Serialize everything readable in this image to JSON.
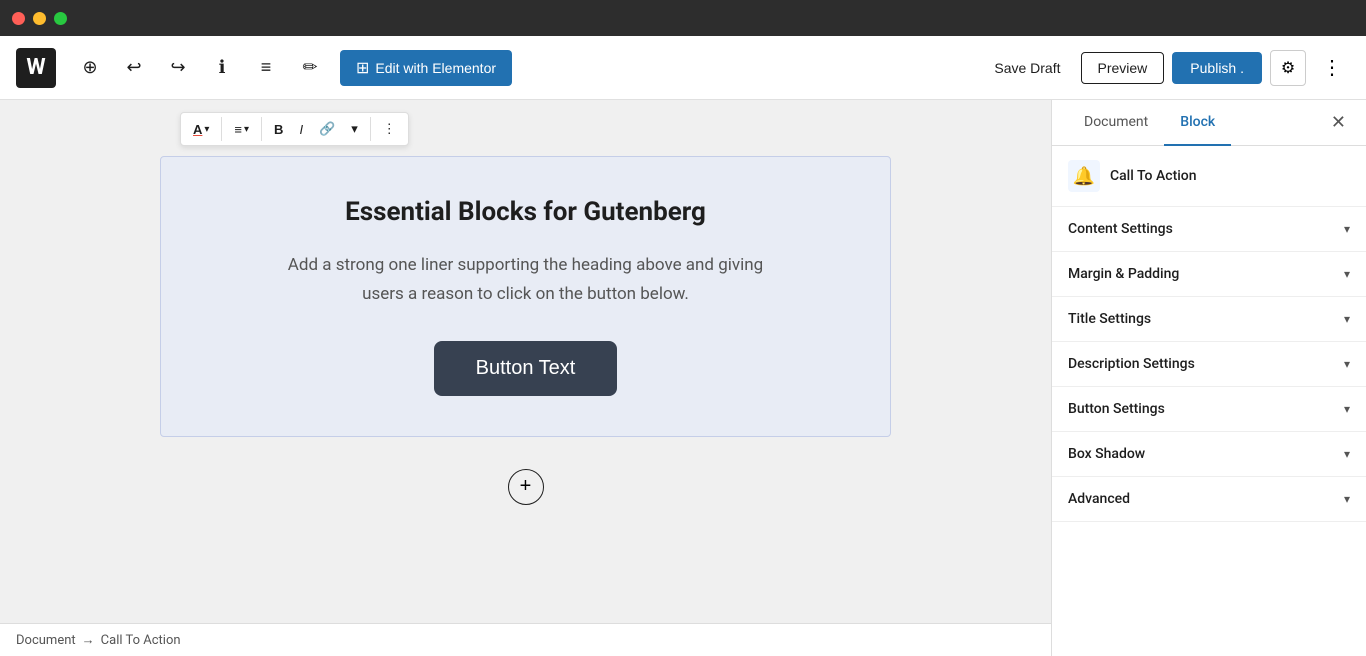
{
  "titlebar": {
    "buttons": [
      "close",
      "minimize",
      "maximize"
    ]
  },
  "toolbar": {
    "wp_logo": "W",
    "elementor_btn_label": "Edit with Elementor",
    "save_draft_label": "Save Draft",
    "preview_label": "Preview",
    "publish_label": "Publish .",
    "add_icon": "⊕",
    "undo_icon": "↩",
    "redo_icon": "↪",
    "info_icon": "ℹ",
    "list_icon": "≡",
    "edit_icon": "✏"
  },
  "block_toolbar": {
    "text_color_icon": "A",
    "align_icon": "≡",
    "bold_label": "B",
    "italic_label": "I",
    "link_icon": "🔗",
    "dropdown_icon": "▾",
    "more_icon": "⋮"
  },
  "cta_block": {
    "title": "Essential Blocks for Gutenberg",
    "description": "Add a strong one liner supporting the heading above and giving users a reason to click on the button below.",
    "button_text": "Button Text"
  },
  "breadcrumb": {
    "document_label": "Document",
    "arrow": "→",
    "block_label": "Call To Action"
  },
  "right_panel": {
    "tabs": [
      {
        "label": "Document",
        "active": false
      },
      {
        "label": "Block",
        "active": true
      }
    ],
    "block_type": {
      "icon": "🔔",
      "label": "Call To Action"
    },
    "accordion_items": [
      {
        "label": "Content Settings",
        "expanded": false
      },
      {
        "label": "Margin & Padding",
        "expanded": false
      },
      {
        "label": "Title Settings",
        "expanded": false
      },
      {
        "label": "Description Settings",
        "expanded": false
      },
      {
        "label": "Button Settings",
        "expanded": false
      },
      {
        "label": "Box Shadow",
        "expanded": false
      },
      {
        "label": "Advanced",
        "expanded": false
      }
    ]
  }
}
